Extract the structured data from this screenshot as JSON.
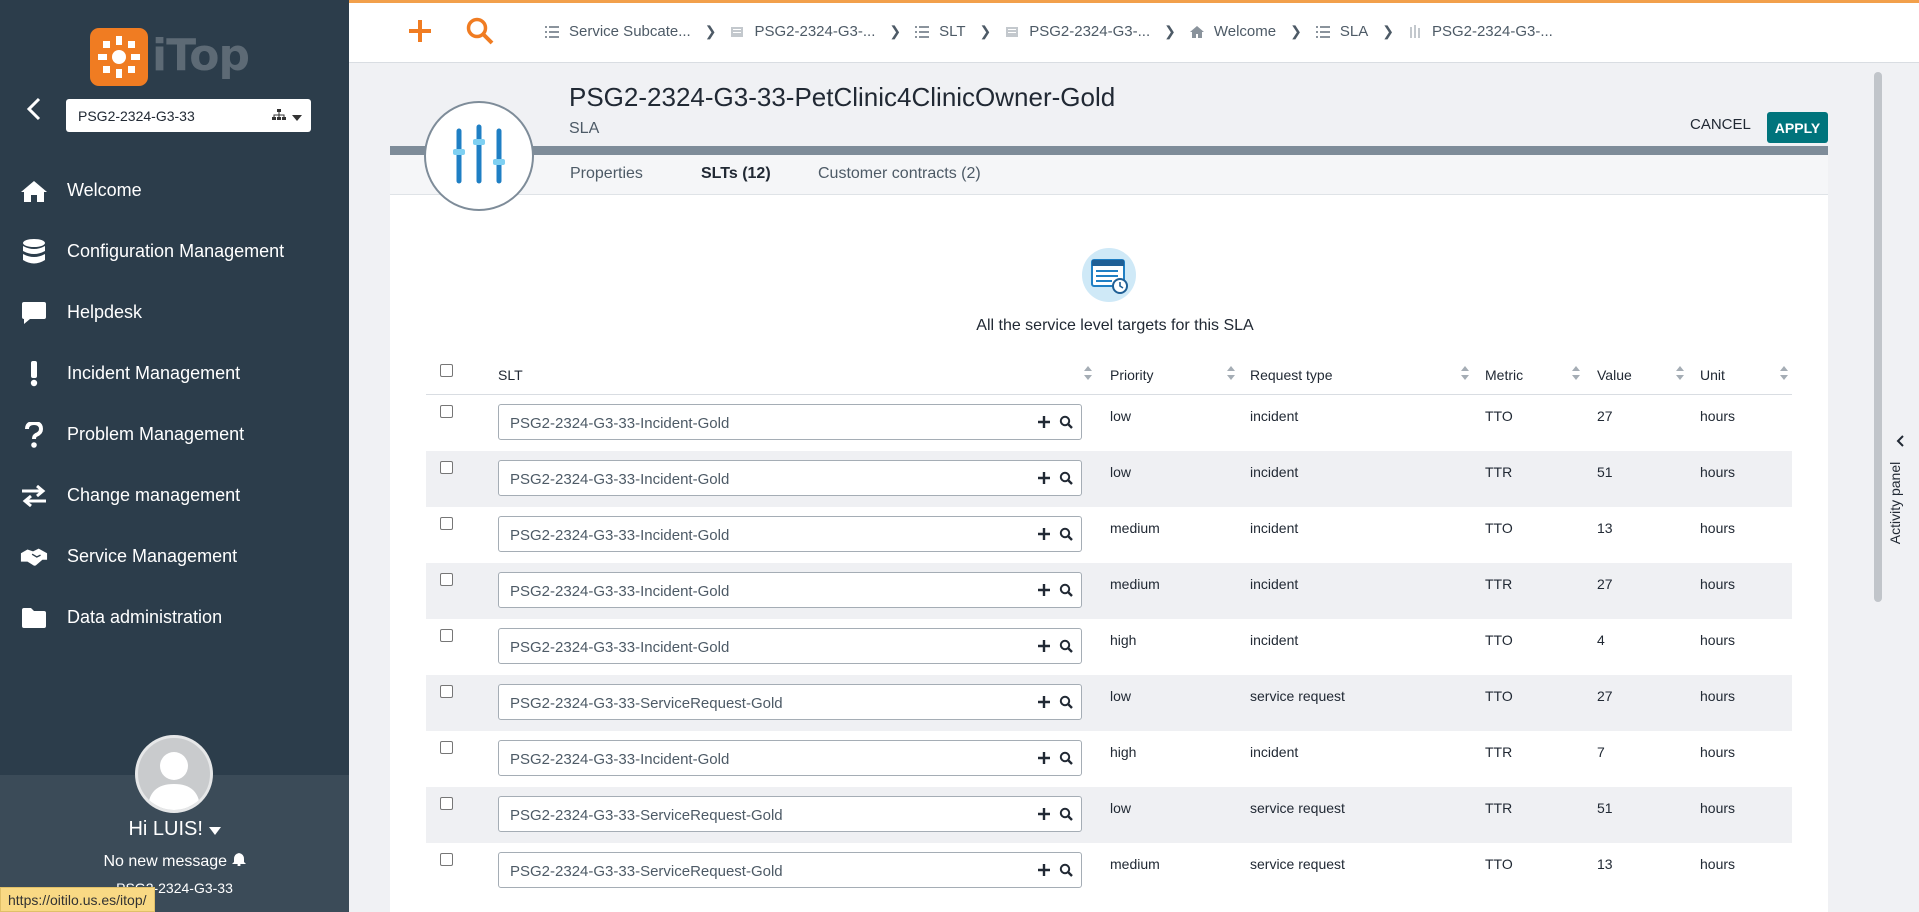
{
  "app": {
    "name": "iTop",
    "status_url": "https://oitilo.us.es/itop/"
  },
  "colors": {
    "sidebar": "#2c3d4b",
    "accent": "#f07c22",
    "apply": "#00747c"
  },
  "sidebar": {
    "org_select": "PSG2-2324-G3-33",
    "items": [
      {
        "label": "Welcome",
        "icon": "home-icon"
      },
      {
        "label": "Configuration Management",
        "icon": "database-icon"
      },
      {
        "label": "Helpdesk",
        "icon": "chat-icon"
      },
      {
        "label": "Incident Management",
        "icon": "exclamation-icon"
      },
      {
        "label": "Problem Management",
        "icon": "question-icon"
      },
      {
        "label": "Change management",
        "icon": "exchange-icon"
      },
      {
        "label": "Service Management",
        "icon": "handshake-icon"
      },
      {
        "label": "Data administration",
        "icon": "folder-icon"
      }
    ],
    "user": {
      "greeting": "Hi LUIS!",
      "messages": "No new message",
      "org": "PSG2-2324-G3-33"
    }
  },
  "breadcrumbs": [
    {
      "label": "Service Subcate...",
      "icon": "list-icon"
    },
    {
      "label": "PSG2-2324-G3-...",
      "icon": "document-icon"
    },
    {
      "label": "SLT",
      "icon": "list-icon"
    },
    {
      "label": "PSG2-2324-G3-...",
      "icon": "document-icon"
    },
    {
      "label": "Welcome",
      "icon": "home-icon"
    },
    {
      "label": "SLA",
      "icon": "list-icon"
    },
    {
      "label": "PSG2-2324-G3-...",
      "icon": "sliders-icon"
    }
  ],
  "object": {
    "title": "PSG2-2324-G3-33-PetClinic4ClinicOwner-Gold",
    "class": "SLA"
  },
  "actions": {
    "cancel": "CANCEL",
    "apply": "APPLY"
  },
  "tabs": [
    {
      "label": "Properties"
    },
    {
      "label": "SLTs (12)"
    },
    {
      "label": "Customer contracts (2)"
    }
  ],
  "activity_panel": "Activity panel",
  "slt_tab": {
    "description": "All the service level targets for this SLA",
    "columns": [
      "SLT",
      "Priority",
      "Request type",
      "Metric",
      "Value",
      "Unit"
    ],
    "rows": [
      {
        "slt": "PSG2-2324-G3-33-Incident-Gold",
        "priority": "low",
        "request_type": "incident",
        "metric": "TTO",
        "value": "27",
        "unit": "hours"
      },
      {
        "slt": "PSG2-2324-G3-33-Incident-Gold",
        "priority": "low",
        "request_type": "incident",
        "metric": "TTR",
        "value": "51",
        "unit": "hours"
      },
      {
        "slt": "PSG2-2324-G3-33-Incident-Gold",
        "priority": "medium",
        "request_type": "incident",
        "metric": "TTO",
        "value": "13",
        "unit": "hours"
      },
      {
        "slt": "PSG2-2324-G3-33-Incident-Gold",
        "priority": "medium",
        "request_type": "incident",
        "metric": "TTR",
        "value": "27",
        "unit": "hours"
      },
      {
        "slt": "PSG2-2324-G3-33-Incident-Gold",
        "priority": "high",
        "request_type": "incident",
        "metric": "TTO",
        "value": "4",
        "unit": "hours"
      },
      {
        "slt": "PSG2-2324-G3-33-ServiceRequest-Gold",
        "priority": "low",
        "request_type": "service request",
        "metric": "TTO",
        "value": "27",
        "unit": "hours"
      },
      {
        "slt": "PSG2-2324-G3-33-Incident-Gold",
        "priority": "high",
        "request_type": "incident",
        "metric": "TTR",
        "value": "7",
        "unit": "hours"
      },
      {
        "slt": "PSG2-2324-G3-33-ServiceRequest-Gold",
        "priority": "low",
        "request_type": "service request",
        "metric": "TTR",
        "value": "51",
        "unit": "hours"
      },
      {
        "slt": "PSG2-2324-G3-33-ServiceRequest-Gold",
        "priority": "medium",
        "request_type": "service request",
        "metric": "TTO",
        "value": "13",
        "unit": "hours"
      }
    ]
  }
}
